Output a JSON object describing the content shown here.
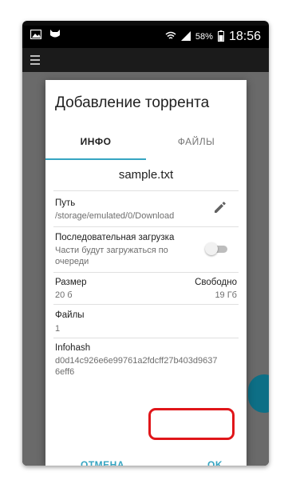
{
  "statusbar": {
    "battery_percent": "58%",
    "time": "18:56"
  },
  "dialog": {
    "title": "Добавление торрента",
    "tabs": [
      {
        "label": "ИНФО",
        "active": true
      },
      {
        "label": "ФАЙЛЫ",
        "active": false
      }
    ],
    "filename": "sample.txt",
    "path": {
      "label": "Путь",
      "value": "/storage/emulated/0/Download"
    },
    "sequential": {
      "label": "Последовательная загрузка",
      "description_line1": "Части будут загружаться по",
      "description_line2": "очереди",
      "enabled": false
    },
    "size": {
      "label": "Размер",
      "value": "20 б"
    },
    "free": {
      "label": "Свободно",
      "value": "19 Гб"
    },
    "files": {
      "label": "Файлы",
      "value": "1"
    },
    "infohash": {
      "label": "Infohash",
      "value_line1": "d0d14c926e6e99761a2fdcff27b403d9637",
      "value_line2": "6eff6"
    },
    "buttons": {
      "cancel": "ОТМЕНА",
      "ok": "OK"
    }
  },
  "colors": {
    "accent": "#36a5c2",
    "highlight": "#e0161a",
    "fab": "#0d6f86"
  }
}
